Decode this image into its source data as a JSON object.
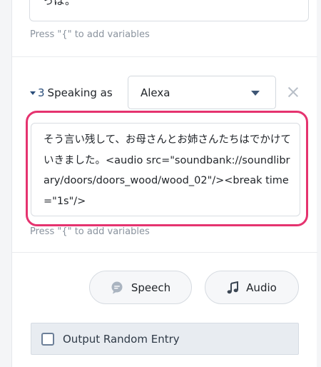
{
  "previous_text": "っぱ。",
  "variables_hint": "Press \"{\" to add variables",
  "step": {
    "number": "3",
    "label": "Speaking as",
    "voice_selected": "Alexa"
  },
  "speech_text": "そう言い残して、お母さんとお姉さんたちはでかけていきました。<audio src=\"soundbank://soundlibrary/doors/doors_wood/wood_02\"/><break time=\"1s\"/>",
  "buttons": {
    "speech": "Speech",
    "audio": "Audio"
  },
  "random_entry_label": "Output Random Entry",
  "icons": {
    "speech": "speech-bubble-icon",
    "audio": "music-note-icon",
    "remove": "close-icon",
    "voice_dropdown": "chevron-down-icon",
    "collapse": "caret-down-icon"
  },
  "colors": {
    "focus": "#e5336f",
    "accent": "#2a4d7a"
  }
}
